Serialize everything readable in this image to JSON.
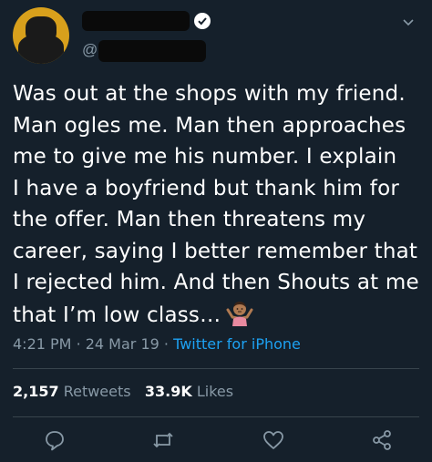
{
  "tweet": {
    "handle_prefix": "@",
    "text": "Was out at the shops with my friend.\nMan ogles me. Man then approaches\nme to give me his number. I explain\nI have a boyfriend but thank him for\nthe offer. Man then threatens my\ncareer, saying I better remember that\nI rejected him. And then Shouts at me\nthat I’m low class…",
    "time": "4:21 PM",
    "date": "24 Mar 19",
    "source": "Twitter for iPhone",
    "retweets_count": "2,157",
    "retweets_label": "Retweets",
    "likes_count": "33.9K",
    "likes_label": "Likes"
  },
  "icons": {
    "verified": "verified-badge-icon",
    "caret": "chevron-down-icon",
    "reply": "reply-icon",
    "retweet": "retweet-icon",
    "like": "heart-icon",
    "share": "share-icon",
    "emoji": "person-shrugging-emoji"
  },
  "colors": {
    "background": "#15202b",
    "text": "#ffffff",
    "muted": "#8899a6",
    "link": "#1da1f2",
    "divider": "#38444d"
  }
}
